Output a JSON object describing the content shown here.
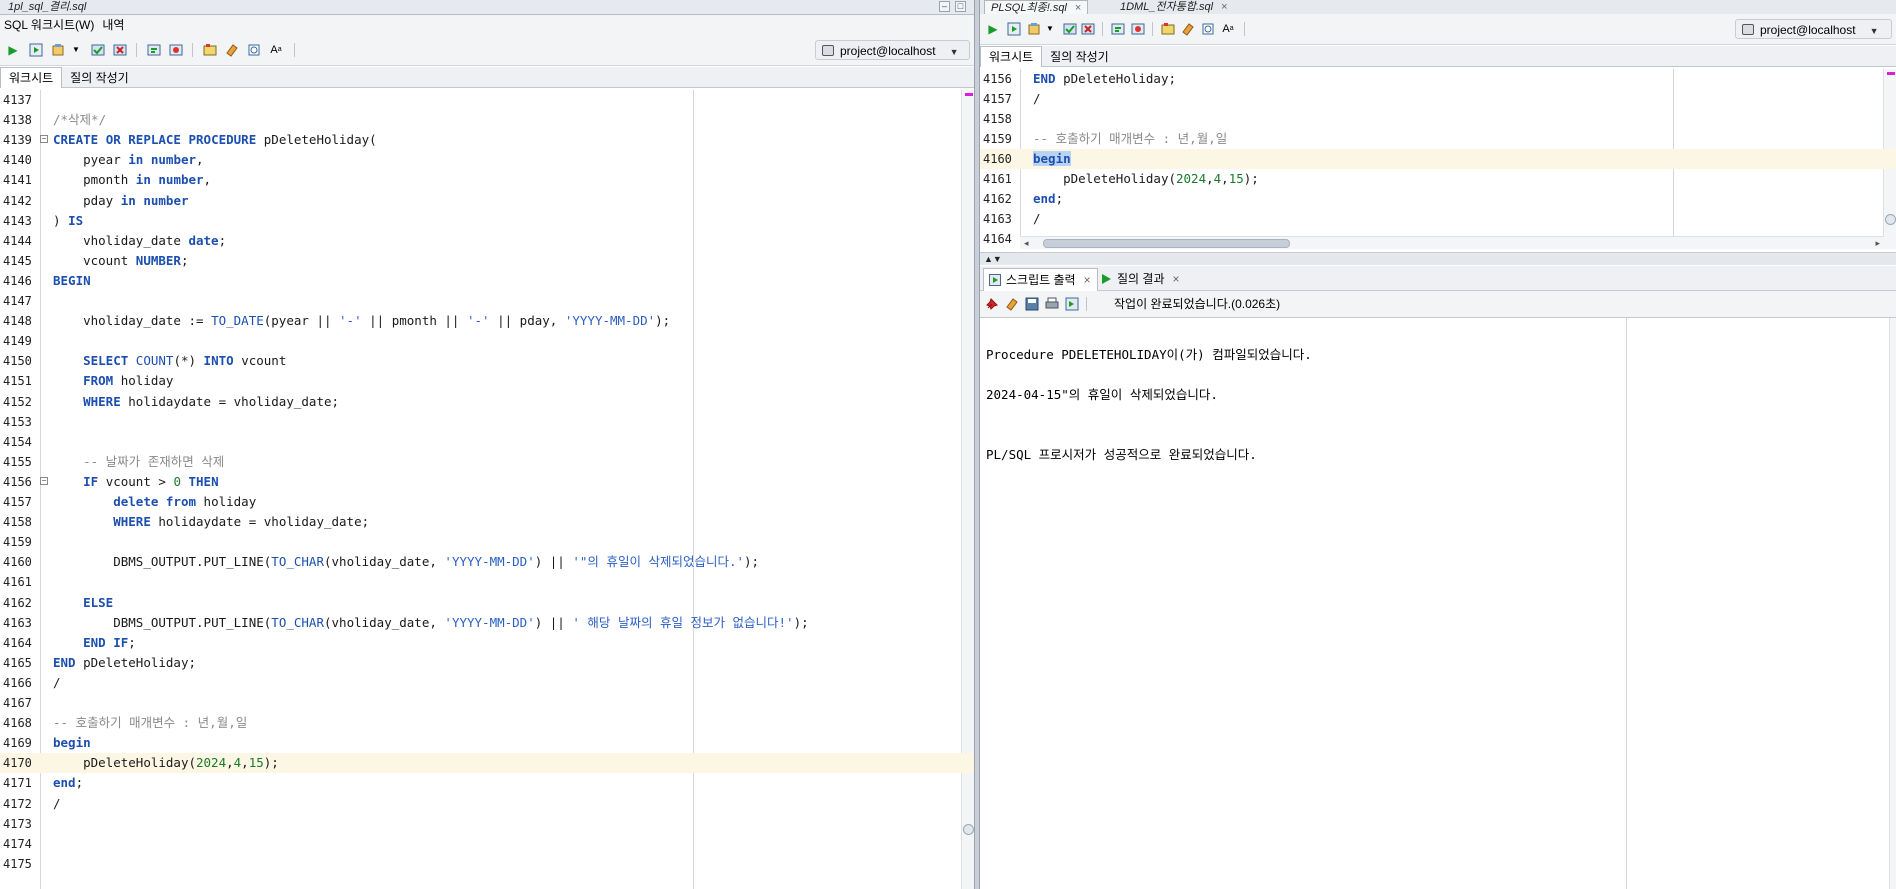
{
  "left": {
    "doc_tab_title": "1pl_sql_결리.sql",
    "menu": [
      "SQL 워크시트(W)",
      "내역"
    ],
    "connection": "project@localhost",
    "subtabs": [
      "워크시트",
      "질의 작성기"
    ],
    "first_line_number": 4137,
    "lines": [
      "",
      "/*삭제*/",
      "CREATE OR REPLACE PROCEDURE pDeleteHoliday(",
      "    pyear in number,",
      "    pmonth in number,",
      "    pday in number",
      ") IS",
      "    vholiday_date date;",
      "    vcount NUMBER;",
      "BEGIN",
      "",
      "    vholiday_date := TO_DATE(pyear || '-' || pmonth || '-' || pday, 'YYYY-MM-DD');",
      "",
      "    SELECT COUNT(*) INTO vcount",
      "    FROM holiday",
      "    WHERE holidaydate = vholiday_date;",
      "",
      "",
      "    -- 날짜가 존재하면 삭제",
      "    IF vcount > 0 THEN",
      "        delete from holiday",
      "        WHERE holidaydate = vholiday_date;",
      "",
      "        DBMS_OUTPUT.PUT_LINE(TO_CHAR(vholiday_date, 'YYYY-MM-DD') || '\"의 휴일이 삭제되었습니다.');",
      "",
      "    ELSE",
      "        DBMS_OUTPUT.PUT_LINE(TO_CHAR(vholiday_date, 'YYYY-MM-DD') || ' 해당 날짜의 휴일 정보가 없습니다!');",
      "    END IF;",
      "END pDeleteHoliday;",
      "/",
      "",
      "-- 호출하기 매개변수 : 년,월,일",
      "begin",
      "    pDeleteHoliday(2024,4,15);",
      "end;",
      "/",
      "",
      "",
      ""
    ]
  },
  "right": {
    "doc_tabs": [
      "PLSQL최종!.sql",
      "1DML_전자통합.sql"
    ],
    "connection": "project@localhost",
    "subtabs": [
      "워크시트",
      "질의 작성기"
    ],
    "first_line_number": 4156,
    "lines": [
      "END pDeleteHoliday;",
      "/",
      "",
      "-- 호출하기 매개변수 : 년,월,일",
      "begin",
      "    pDeleteHoliday(2024,4,15);",
      "end;",
      "/",
      ""
    ],
    "output_tabs": [
      "스크립트 출력",
      "질의 결과"
    ],
    "status": "작업이 완료되었습니다.(0.026초)",
    "output_lines": [
      "Procedure PDELETEHOLIDAY이(가) 컴파일되었습니다.",
      "2024-04-15\"의 휴일이 삭제되었습니다.",
      "PL/SQL 프로시저가 성공적으로 완료되었습니다."
    ]
  },
  "colors": {
    "keyword": "#1c4fb0",
    "string": "#2b5fc4",
    "number": "#1a7a2a",
    "comment": "#8a8a8a",
    "current_line": "#fbf7e4",
    "selection": "#b9d3f5"
  }
}
